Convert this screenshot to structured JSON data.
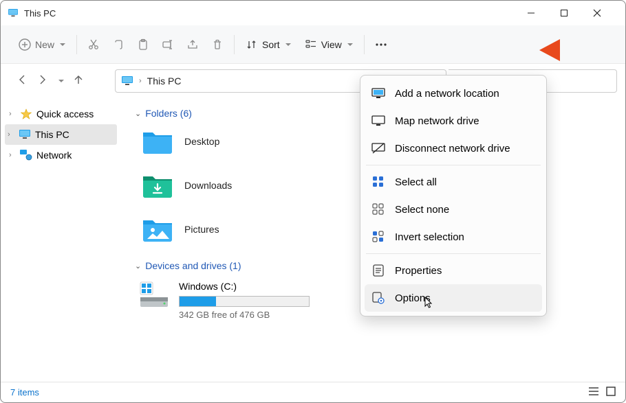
{
  "window": {
    "title": "This PC"
  },
  "toolbar": {
    "new_label": "New",
    "sort_label": "Sort",
    "view_label": "View"
  },
  "breadcrumb": {
    "location": "This PC"
  },
  "sidebar": {
    "items": [
      {
        "label": "Quick access"
      },
      {
        "label": "This PC"
      },
      {
        "label": "Network"
      }
    ]
  },
  "sections": {
    "folders": {
      "header": "Folders (6)",
      "items": [
        {
          "label": "Desktop"
        },
        {
          "label": "Downloads"
        },
        {
          "label": "Pictures"
        }
      ]
    },
    "drives": {
      "header": "Devices and drives (1)",
      "items": [
        {
          "label": "Windows (C:)",
          "subtext": "342 GB free of 476 GB",
          "fill_percent": 28
        }
      ]
    }
  },
  "menu": {
    "items": [
      {
        "label": "Add a network location"
      },
      {
        "label": "Map network drive"
      },
      {
        "label": "Disconnect network drive"
      },
      {
        "label": "Select all"
      },
      {
        "label": "Select none"
      },
      {
        "label": "Invert selection"
      },
      {
        "label": "Properties"
      },
      {
        "label": "Options"
      }
    ]
  },
  "status": {
    "text": "7 items"
  },
  "colors": {
    "accent": "#1e9de8",
    "annotation": "#e8491c"
  }
}
